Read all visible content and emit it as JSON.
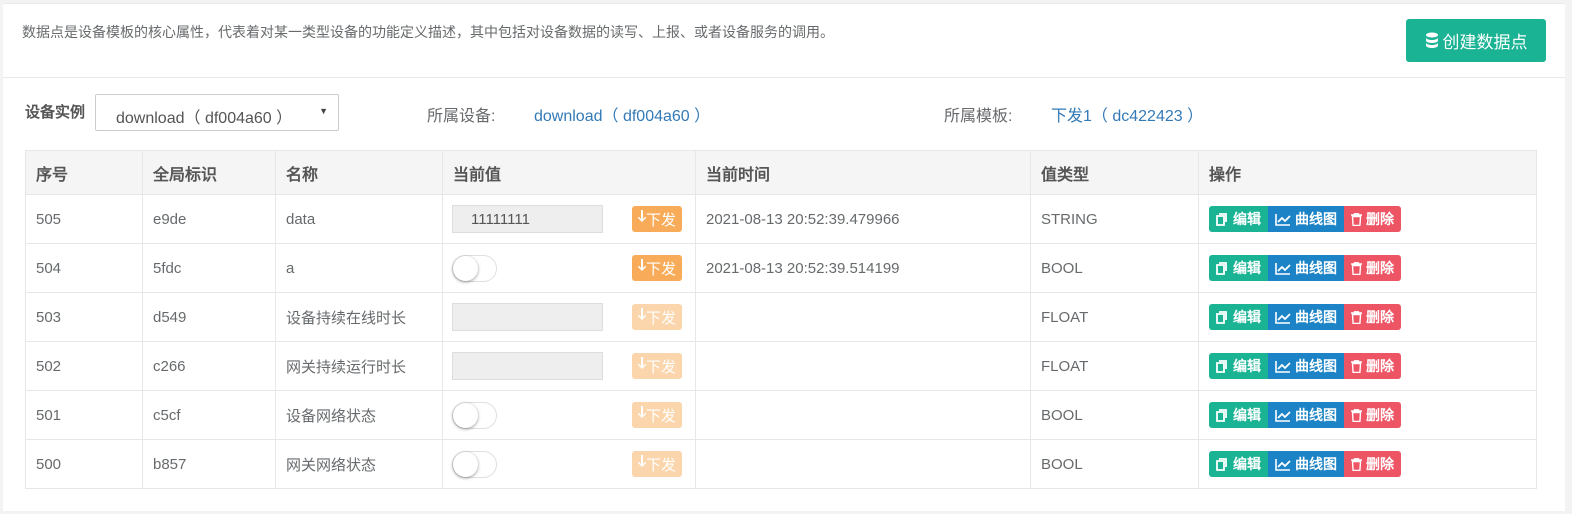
{
  "header": {
    "description": "数据点是设备模板的核心属性，代表着对某一类型设备的功能定义描述，其中包括对设备数据的读写、上报、或者设备服务的调用。",
    "create_button": "创建数据点"
  },
  "filter": {
    "label": "设备实例",
    "selected": "download（ df004a60 ）",
    "device_label": "所属设备:",
    "device_value": "download（ df004a60 ）",
    "template_label": "所属模板:",
    "template_value": "下发1（ dc422423 ）"
  },
  "table": {
    "headers": [
      "序号",
      "全局标识",
      "名称",
      "当前值",
      "当前时间",
      "值类型",
      "操作"
    ],
    "send_label": "下发",
    "edit_label": "编辑",
    "curve_label": "曲线图",
    "delete_label": "删除",
    "rows": [
      {
        "id": "505",
        "key": "e9de",
        "name": "data",
        "value_kind": "input",
        "value": "11111111",
        "send_enabled": true,
        "time": "2021-08-13 20:52:39.479966",
        "type": "STRING"
      },
      {
        "id": "504",
        "key": "5fdc",
        "name": "a",
        "value_kind": "toggle",
        "value": "",
        "send_enabled": true,
        "time": "2021-08-13 20:52:39.514199",
        "type": "BOOL"
      },
      {
        "id": "503",
        "key": "d549",
        "name": "设备持续在线时长",
        "value_kind": "input",
        "value": "",
        "send_enabled": false,
        "time": "",
        "type": "FLOAT"
      },
      {
        "id": "502",
        "key": "c266",
        "name": "网关持续运行时长",
        "value_kind": "input",
        "value": "",
        "send_enabled": false,
        "time": "",
        "type": "FLOAT"
      },
      {
        "id": "501",
        "key": "c5cf",
        "name": "设备网络状态",
        "value_kind": "toggle",
        "value": "",
        "send_enabled": false,
        "time": "",
        "type": "BOOL"
      },
      {
        "id": "500",
        "key": "b857",
        "name": "网关网络状态",
        "value_kind": "toggle",
        "value": "",
        "send_enabled": false,
        "time": "",
        "type": "BOOL"
      }
    ]
  },
  "colors": {
    "primary": "#1ab394",
    "info": "#1c84c6",
    "danger": "#ed5565",
    "warning": "#f8ac59",
    "link": "#337ab7"
  },
  "icons": {
    "create": "database-icon",
    "send": "arrow-down-icon",
    "edit": "copy-icon",
    "curve": "line-chart-icon",
    "delete": "trash-icon"
  }
}
